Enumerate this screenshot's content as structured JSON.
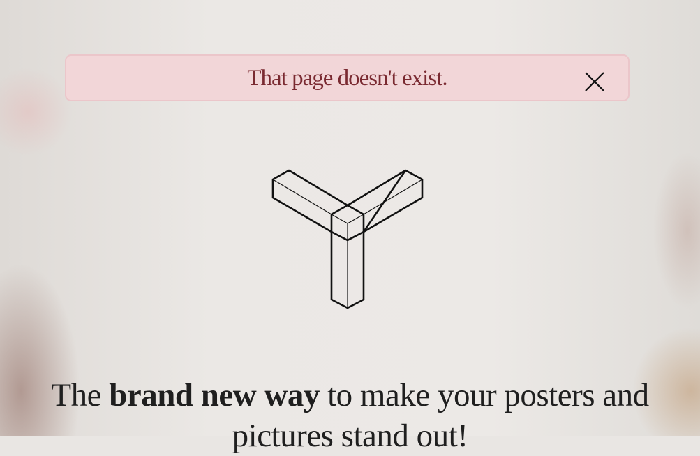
{
  "alert": {
    "message": "That page doesn't exist."
  },
  "icons": {
    "close": "close-icon",
    "logo": "tri-beam-logo-icon"
  },
  "hero": {
    "headline_pre": "The ",
    "headline_bold": "brand new way",
    "headline_post": " to make your posters and pictures stand out!"
  },
  "colors": {
    "alert_bg": "#f2d6d8",
    "alert_border": "#ebc6ca",
    "alert_text": "#7a2a31",
    "headline_text": "#1f1f1f"
  }
}
